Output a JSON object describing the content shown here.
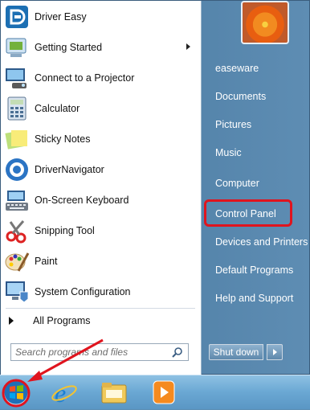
{
  "start_menu": {
    "programs": [
      {
        "label": "Driver Easy",
        "icon": "driver-easy-icon",
        "submenu": false
      },
      {
        "label": "Getting Started",
        "icon": "getting-started-icon",
        "submenu": true
      },
      {
        "label": "Connect to a Projector",
        "icon": "projector-icon",
        "submenu": false
      },
      {
        "label": "Calculator",
        "icon": "calculator-icon",
        "submenu": false
      },
      {
        "label": "Sticky Notes",
        "icon": "sticky-notes-icon",
        "submenu": false
      },
      {
        "label": "DriverNavigator",
        "icon": "drivernavigator-icon",
        "submenu": false
      },
      {
        "label": "On-Screen Keyboard",
        "icon": "keyboard-icon",
        "submenu": false
      },
      {
        "label": "Snipping Tool",
        "icon": "snipping-tool-icon",
        "submenu": false
      },
      {
        "label": "Paint",
        "icon": "paint-icon",
        "submenu": false
      },
      {
        "label": "System Configuration",
        "icon": "system-configuration-icon",
        "submenu": false
      }
    ],
    "all_programs_label": "All Programs",
    "search_placeholder": "Search programs and files",
    "right_items": [
      "easeware",
      "Documents",
      "Pictures",
      "Music",
      "Computer",
      "Control Panel",
      "Devices and Printers",
      "Default Programs",
      "Help and Support"
    ],
    "highlighted_item": "Control Panel",
    "shutdown_label": "Shut down"
  },
  "taskbar": {
    "items": [
      "start-orb-icon",
      "internet-explorer-icon",
      "file-explorer-icon",
      "media-player-icon"
    ]
  },
  "colors": {
    "highlight": "#e0141e",
    "annotation_arrow": "#e0141e"
  }
}
